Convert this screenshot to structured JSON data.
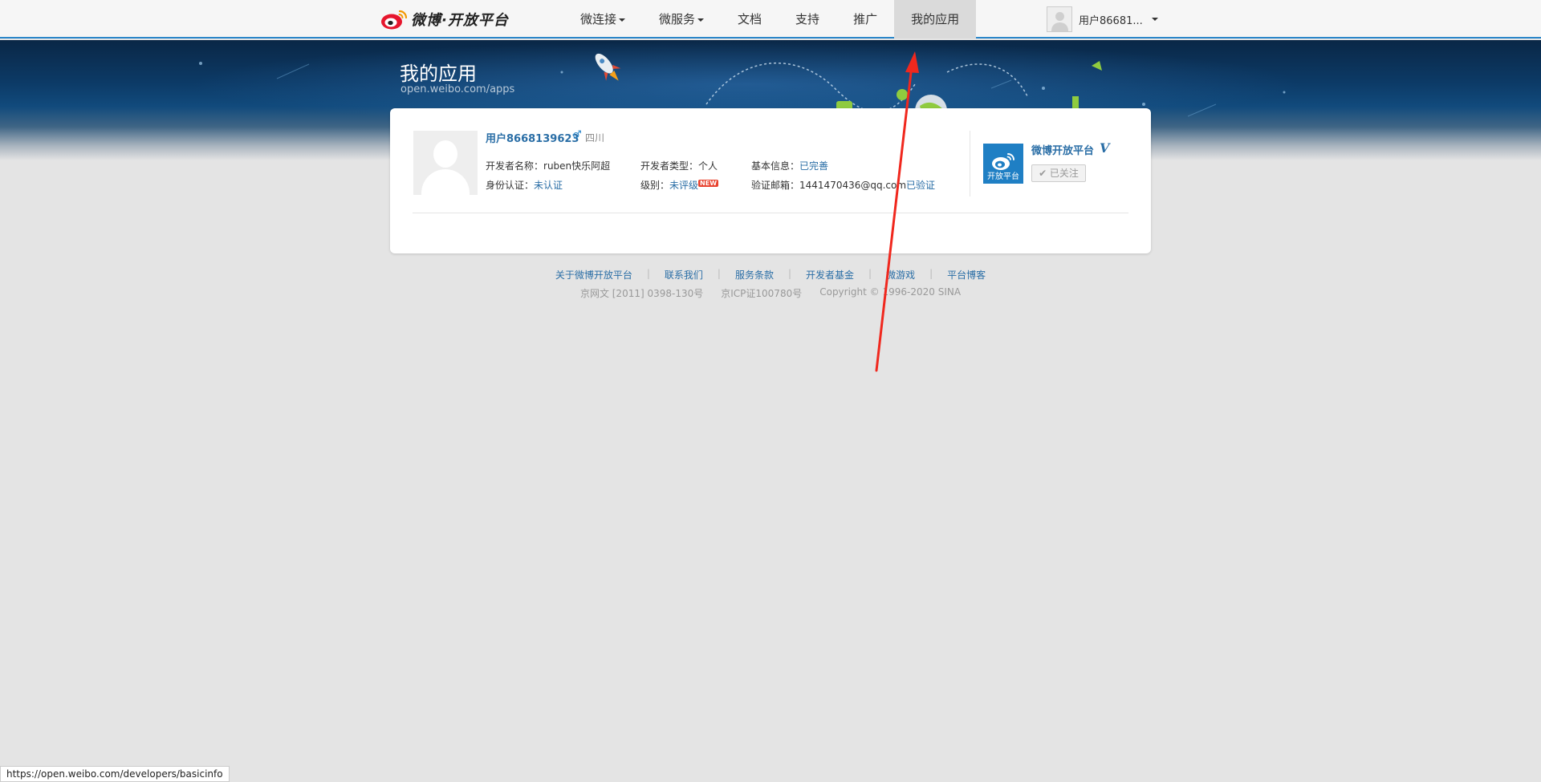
{
  "header": {
    "logo_text": "微博·开放平台",
    "nav": [
      {
        "label": "微连接",
        "dropdown": true
      },
      {
        "label": "微服务",
        "dropdown": true
      },
      {
        "label": "文档",
        "dropdown": false
      },
      {
        "label": "支持",
        "dropdown": false
      },
      {
        "label": "推广",
        "dropdown": false
      },
      {
        "label": "我的应用",
        "dropdown": false,
        "active": true
      }
    ],
    "user_label": "用户86681..."
  },
  "banner": {
    "title": "我的应用",
    "url": "open.weibo.com/apps"
  },
  "profile": {
    "name": "用户8668139623",
    "gender_symbol": "♂",
    "location": "四川",
    "developer_name_label": "开发者名称：",
    "developer_name": "ruben快乐阿超",
    "developer_type_label": "开发者类型：",
    "developer_type": "个人",
    "basic_info_label": "基本信息：",
    "basic_info_status": "已完善",
    "identity_label": "身份认证：",
    "identity_status": "未认证",
    "level_label": "级别：",
    "level_status": "未评级",
    "new_badge": "NEW",
    "email_label": "验证邮箱：",
    "email": "1441470436@qq.com",
    "email_status": "已验证"
  },
  "brand": {
    "name": "微博开放平台",
    "v_badge": "V",
    "logo_text": "开放平台",
    "follow_label": "✔ 已关注"
  },
  "footer": {
    "links": [
      "关于微博开放平台",
      "联系我们",
      "服务条款",
      "开发者基金",
      "微游戏",
      "平台博客"
    ],
    "separator": "|",
    "license1": "京网文 [2011] 0398-130号",
    "license2": "京ICP证100780号",
    "copyright": "Copyright © 1996-2020 SINA"
  },
  "status_url": "https://open.weibo.com/developers/basicinfo",
  "colors": {
    "accent": "#2a86c9",
    "link": "#2a6ea6",
    "annotation_arrow": "#f0281e"
  }
}
